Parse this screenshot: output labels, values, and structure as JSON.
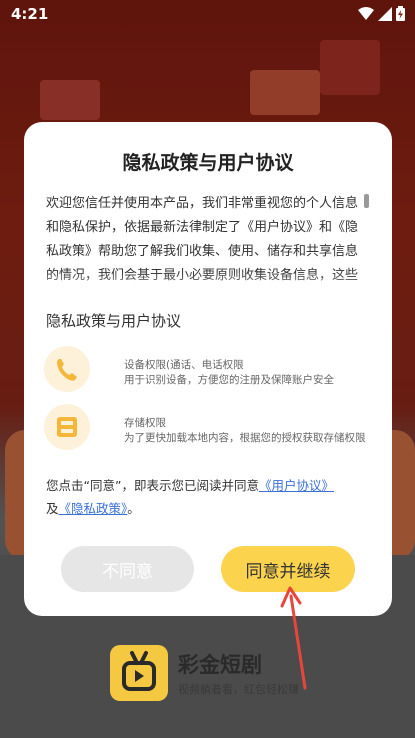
{
  "status_bar": {
    "time": "4:21"
  },
  "dialog": {
    "title": "隐私政策与用户协议",
    "body": "欢迎您信任并使用本产品，我们非常重视您的个人信息和隐私保护，依据最新法律制定了《用户协议》和《隐私政策》帮助您了解我们收集、使用、储存和共享信息的情况，我们会基于最小必要原则收集设备信息，这些信息用于为您提供服务…",
    "subtitle": "隐私政策与用户协议",
    "permissions": [
      {
        "icon": "phone-icon",
        "title": "设备权限(通话、电话权限",
        "desc": "用于识别设备，方便您的注册及保障账户安全"
      },
      {
        "icon": "storage-icon",
        "title": "存储权限",
        "desc": "为了更快加载本地内容，根据您的授权获取存储权限"
      }
    ],
    "agreement": {
      "prefix": "您点击“同意”，即表示您已阅读并同意",
      "user_agreement_link": "《用户协议》",
      "conjunction": "及",
      "privacy_policy_link": "《隐私政策》",
      "suffix": "。"
    },
    "decline_label": "不同意",
    "accept_label": "同意并继续"
  },
  "brand": {
    "name": "彩金短剧",
    "slogan": "视频躺着看，红包轻松赚"
  },
  "colors": {
    "accent": "#fcd34d",
    "link": "#3a70d8",
    "arrow": "#e8463c",
    "icon_bg": "#fdf1d9"
  }
}
